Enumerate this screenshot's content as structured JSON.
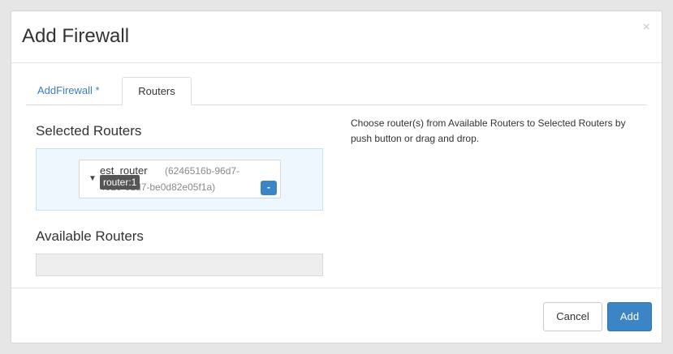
{
  "modal": {
    "title": "Add Firewall",
    "close_label": "×"
  },
  "tabs": [
    {
      "label": "AddFirewall *",
      "active": false
    },
    {
      "label": "Routers",
      "active": true
    }
  ],
  "selected_routers": {
    "title": "Selected Routers",
    "items": [
      {
        "name": "est_router",
        "id_line1": "(6246516b-96d7-",
        "id_line2": "4520-81d7-be0d82e05f1a)",
        "tooltip": "router:1",
        "remove_label": "-"
      }
    ]
  },
  "available_routers": {
    "title": "Available Routers"
  },
  "help": {
    "text": "Choose router(s) from Available Routers to Selected Routers by push button or drag and drop."
  },
  "footer": {
    "cancel_label": "Cancel",
    "add_label": "Add"
  },
  "colors": {
    "primary": "#3b84c6",
    "link": "#3b7cc4",
    "selected_bg": "#eef7fd",
    "tooltip_bg": "#555555"
  },
  "icons": {
    "close": "close-icon",
    "chevron": "chevron-down-icon"
  }
}
